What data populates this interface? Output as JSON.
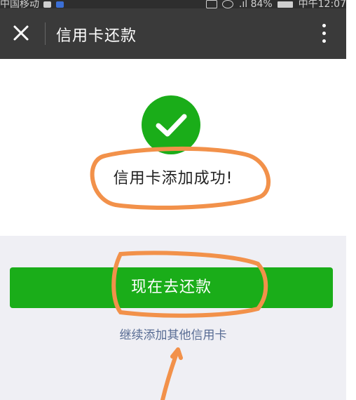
{
  "status_bar": {
    "carrier": "中国移动",
    "battery": "84%",
    "time": "中午12:07"
  },
  "header": {
    "title": "信用卡还款",
    "close_icon": "close-icon",
    "more_icon": "more-vertical-icon"
  },
  "result": {
    "icon": "check-circle-icon",
    "message": "信用卡添加成功!"
  },
  "actions": {
    "primary_label": "现在去还款",
    "secondary_label": "继续添加其他信用卡"
  },
  "colors": {
    "primary_green": "#1aad19",
    "link_blue": "#586c94",
    "header_bg": "#3a3a3a",
    "annotation_orange": "#f2914a"
  }
}
